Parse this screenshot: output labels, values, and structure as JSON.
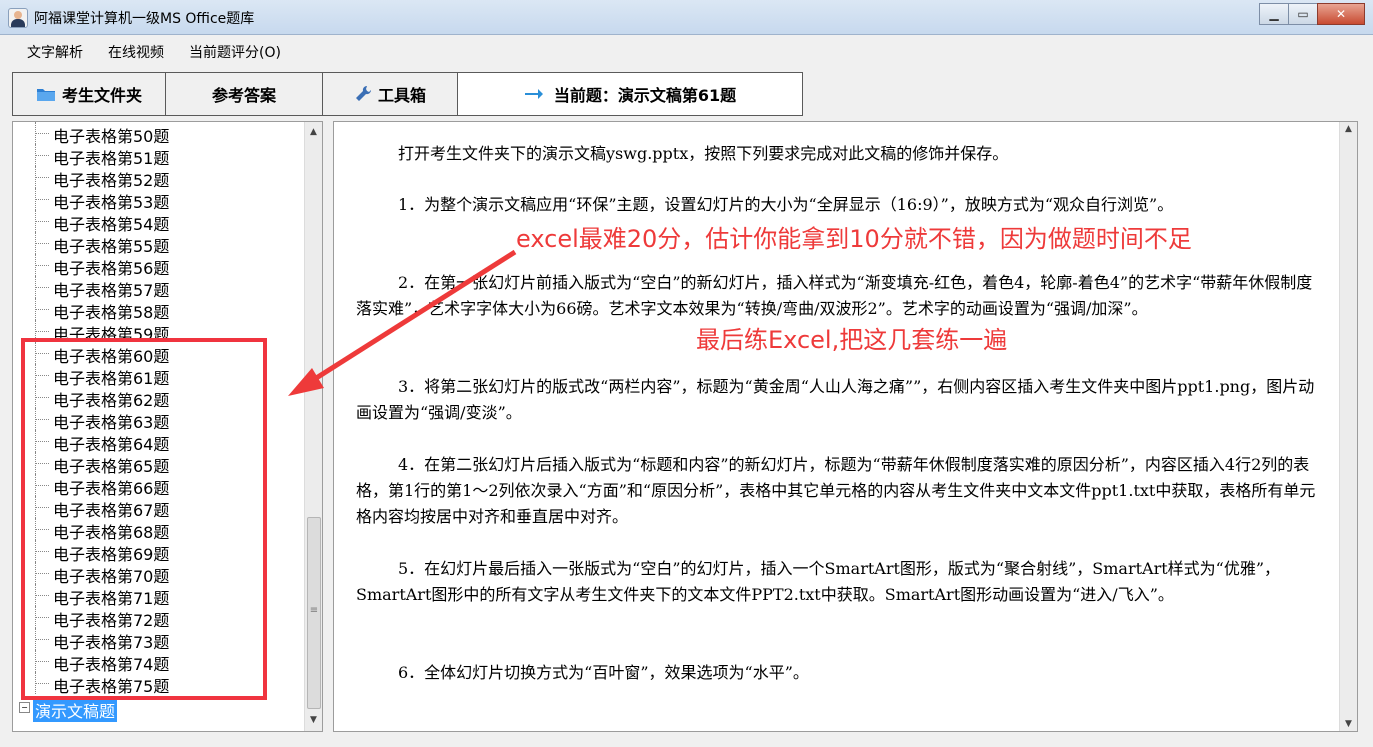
{
  "window": {
    "title": "阿福课堂计算机一级MS Office题库"
  },
  "menu": {
    "items": [
      "文字解析",
      "在线视频",
      "当前题评分(O)"
    ]
  },
  "tabs": [
    {
      "label": "考生文件夹",
      "icon": "folder-icon"
    },
    {
      "label": "参考答案",
      "icon": ""
    },
    {
      "label": "工具箱",
      "icon": "wrench-icon"
    },
    {
      "label": "当前题：演示文稿第61题",
      "icon": "arrow-right-icon"
    }
  ],
  "tree": {
    "items": [
      "电子表格第50题",
      "电子表格第51题",
      "电子表格第52题",
      "电子表格第53题",
      "电子表格第54题",
      "电子表格第55题",
      "电子表格第56题",
      "电子表格第57题",
      "电子表格第58题",
      "电子表格第59题",
      "电子表格第60题",
      "电子表格第61题",
      "电子表格第62题",
      "电子表格第63题",
      "电子表格第64题",
      "电子表格第65题",
      "电子表格第66题",
      "电子表格第67题",
      "电子表格第68题",
      "电子表格第69题",
      "电子表格第70题",
      "电子表格第71题",
      "电子表格第72题",
      "电子表格第73题",
      "电子表格第74题",
      "电子表格第75题"
    ],
    "selected_node": "演示文稿题"
  },
  "content": {
    "paragraphs": [
      "打开考生文件夹下的演示文稿yswg.pptx，按照下列要求完成对此文稿的修饰并保存。",
      "1．为整个演示文稿应用“环保”主题，设置幻灯片的大小为“全屏显示（16:9）”，放映方式为“观众自行浏览”。",
      "2．在第一张幻灯片前插入版式为“空白”的新幻灯片，插入样式为“渐变填充-红色，着色4，轮廓-着色4”的艺术字“带薪年休假制度落实难”，艺术字字体大小为66磅。艺术字文本效果为“转换/弯曲/双波形2”。艺术字的动画设置为“强调/加深”。",
      "3．将第二张幻灯片的版式改“两栏内容”，标题为“黄金周“人山人海之痛””，右侧内容区插入考生文件夹中图片ppt1.png，图片动画设置为“强调/变淡”。",
      "4．在第二张幻灯片后插入版式为“标题和内容”的新幻灯片，标题为“带薪年休假制度落实难的原因分析”，内容区插入4行2列的表格，第1行的第1～2列依次录入“方面”和“原因分析”，表格中其它单元格的内容从考生文件夹中文本文件ppt1.txt中获取，表格所有单元格内容均按居中对齐和垂直居中对齐。",
      "5．在幻灯片最后插入一张版式为“空白”的幻灯片，插入一个SmartArt图形，版式为“聚合射线”，SmartArt样式为“优雅”， SmartArt图形中的所有文字从考生文件夹下的文本文件PPT2.txt中获取。SmartArt图形动画设置为“进入/飞入”。",
      "6．全体幻灯片切换方式为“百叶窗”，效果选项为“水平”。"
    ]
  },
  "annotations": {
    "note1": "excel最难20分，估计你能拿到10分就不错，因为做题时间不足",
    "note2": "最后练Excel,把这几套练一遍",
    "color": "#ee3a3a"
  }
}
